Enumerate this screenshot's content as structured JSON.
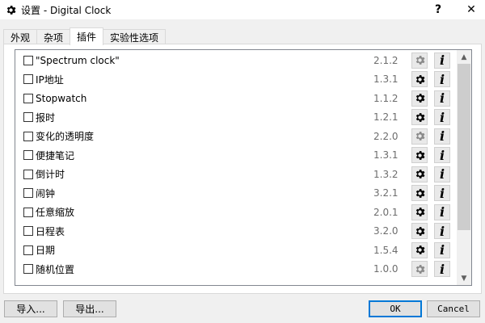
{
  "window": {
    "title": "设置 - Digital Clock",
    "help_label": "?",
    "close_label": "✕"
  },
  "tabs": [
    {
      "label": "外观"
    },
    {
      "label": "杂项"
    },
    {
      "label": "插件",
      "active": true
    },
    {
      "label": "实验性选项"
    }
  ],
  "plugins": [
    {
      "name": "\"Spectrum clock\"",
      "version": "2.1.2",
      "checked": false,
      "settings_enabled": false
    },
    {
      "name": "IP地址",
      "version": "1.3.1",
      "checked": false,
      "settings_enabled": true
    },
    {
      "name": "Stopwatch",
      "version": "1.1.2",
      "checked": false,
      "settings_enabled": true
    },
    {
      "name": "报时",
      "version": "1.2.1",
      "checked": false,
      "settings_enabled": true
    },
    {
      "name": "变化的透明度",
      "version": "2.2.0",
      "checked": false,
      "settings_enabled": false
    },
    {
      "name": "便捷笔记",
      "version": "1.3.1",
      "checked": false,
      "settings_enabled": true
    },
    {
      "name": "倒计时",
      "version": "1.3.2",
      "checked": false,
      "settings_enabled": true
    },
    {
      "name": "闹钟",
      "version": "3.2.1",
      "checked": false,
      "settings_enabled": true
    },
    {
      "name": "任意缩放",
      "version": "2.0.1",
      "checked": false,
      "settings_enabled": true
    },
    {
      "name": "日程表",
      "version": "3.2.0",
      "checked": false,
      "settings_enabled": true
    },
    {
      "name": "日期",
      "version": "1.5.4",
      "checked": false,
      "settings_enabled": true
    },
    {
      "name": "随机位置",
      "version": "1.0.0",
      "checked": false,
      "settings_enabled": false
    }
  ],
  "info_label": "i",
  "buttons": {
    "import": "导入...",
    "export": "导出...",
    "ok": "OK",
    "cancel": "Cancel"
  },
  "colors": {
    "accent": "#0078d7",
    "gear_enabled": "#000000",
    "gear_disabled": "#8a8a8a"
  }
}
